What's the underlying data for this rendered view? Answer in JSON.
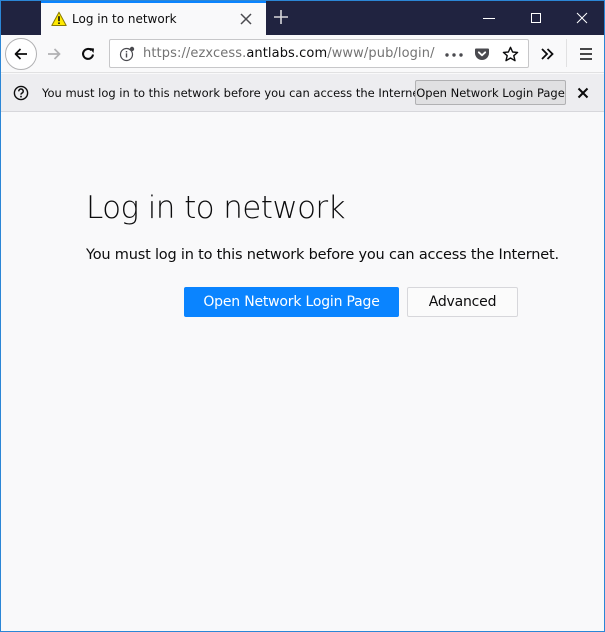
{
  "window": {
    "accent_color": "#0a84ff",
    "titlebar_color": "#202340",
    "controls": {
      "minimize_icon": "minimize-icon",
      "maximize_icon": "maximize-icon",
      "close_icon": "close-icon"
    }
  },
  "tabs": [
    {
      "title": "Log in to network",
      "icon": "warning-icon",
      "active": true
    }
  ],
  "toolbar": {
    "back_icon": "back-arrow-icon",
    "forward_icon": "forward-arrow-icon",
    "reload_icon": "reload-icon",
    "url": {
      "prefix": "https://ezxcess.",
      "domain": "antlabs.com",
      "path": "/www/pub/login/"
    },
    "page_actions": [
      "more-icon",
      "pocket-icon",
      "bookmark-star-icon"
    ],
    "overflow_icon": "overflow-chevron-icon",
    "menu_icon": "hamburger-menu-icon"
  },
  "notification": {
    "icon": "help-question-icon",
    "message": "You must log in to this network before you can access the Internet.",
    "button_label": "Open Network Login Page",
    "close_icon": "close-icon"
  },
  "main": {
    "title": "Log in to network",
    "description": "You must log in to this network before you can access the Internet.",
    "primary_button": "Open Network Login Page",
    "secondary_button": "Advanced",
    "primary_color": "#0a84ff"
  }
}
